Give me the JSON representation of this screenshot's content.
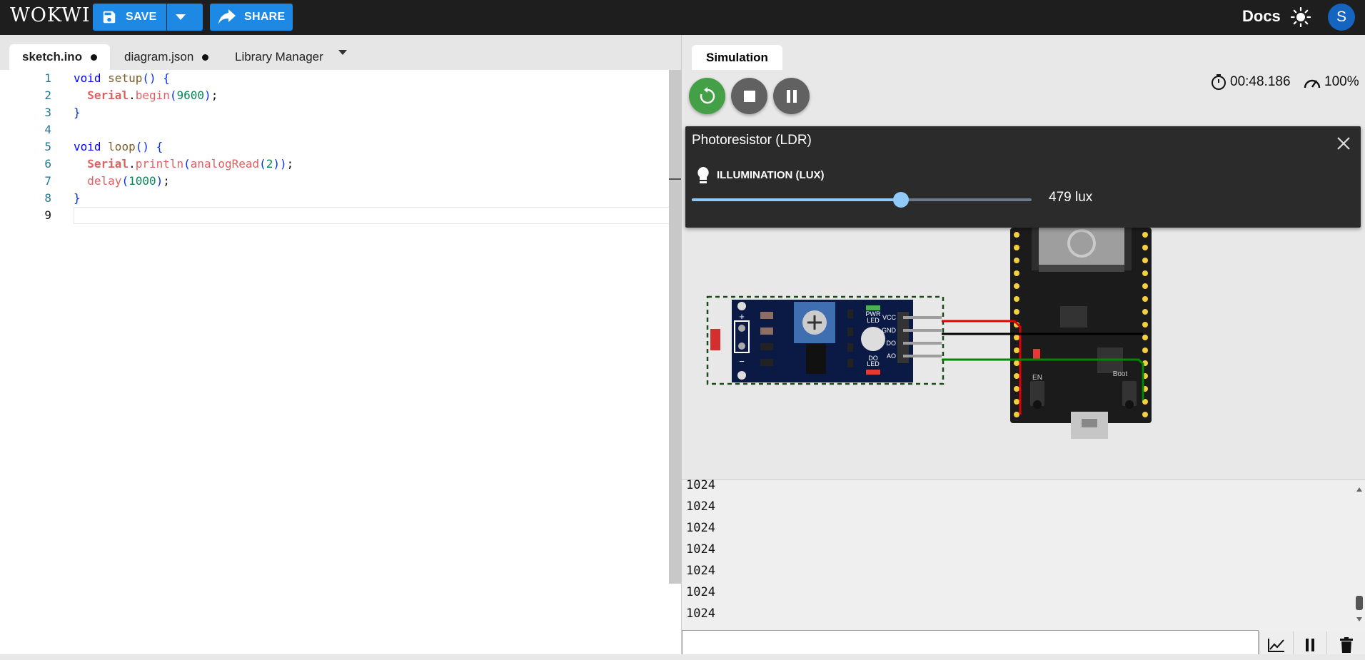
{
  "app": {
    "logo": "WOKWI",
    "save_label": "SAVE",
    "share_label": "SHARE",
    "docs_label": "Docs",
    "avatar_initial": "S"
  },
  "editor": {
    "tabs": [
      {
        "label": "sketch.ino",
        "modified": true,
        "active": true
      },
      {
        "label": "diagram.json",
        "modified": true,
        "active": false
      },
      {
        "label": "Library Manager",
        "modified": false,
        "active": false
      }
    ],
    "lines": [
      {
        "n": "1",
        "code": "void setup() {"
      },
      {
        "n": "2",
        "code": "  Serial.begin(9600);"
      },
      {
        "n": "3",
        "code": "}"
      },
      {
        "n": "4",
        "code": ""
      },
      {
        "n": "5",
        "code": "void loop() {"
      },
      {
        "n": "6",
        "code": "  Serial.println(analogRead(2));"
      },
      {
        "n": "7",
        "code": "  delay(1000);"
      },
      {
        "n": "8",
        "code": "}"
      },
      {
        "n": "9",
        "code": ""
      }
    ]
  },
  "simulation": {
    "tab_label": "Simulation",
    "timer": "00:48.186",
    "speed": "100%",
    "popup": {
      "title": "Photoresistor (LDR)",
      "control_label": "ILLUMINATION (LUX)",
      "slider_fraction": 0.615,
      "value_text": "479 lux"
    },
    "sensor_labels": {
      "pwr_led": "PWR\nLED",
      "do_led": "DO\nLED",
      "pins": [
        "VCC",
        "GND",
        "DO",
        "AO"
      ],
      "plus": "+",
      "minus": "−"
    },
    "board_labels": {
      "en": "EN",
      "boot": "Boot"
    },
    "serial_lines": [
      "1024",
      "1024",
      "1024",
      "1024",
      "1024",
      "1024",
      "1024"
    ]
  },
  "colors": {
    "topbar": "#1e1e1e",
    "accent": "#1e88e5",
    "restart": "#43a047",
    "wire_vcc": "#e00000",
    "wire_gnd": "#000000",
    "wire_ao": "#008800"
  },
  "icons": [
    "save-icon",
    "dropdown-icon",
    "share-icon",
    "theme-sun-icon",
    "restart-icon",
    "stop-icon",
    "pause-icon",
    "timer-icon",
    "speed-icon",
    "close-icon",
    "bulb-icon",
    "plotter-icon",
    "trash-icon"
  ]
}
